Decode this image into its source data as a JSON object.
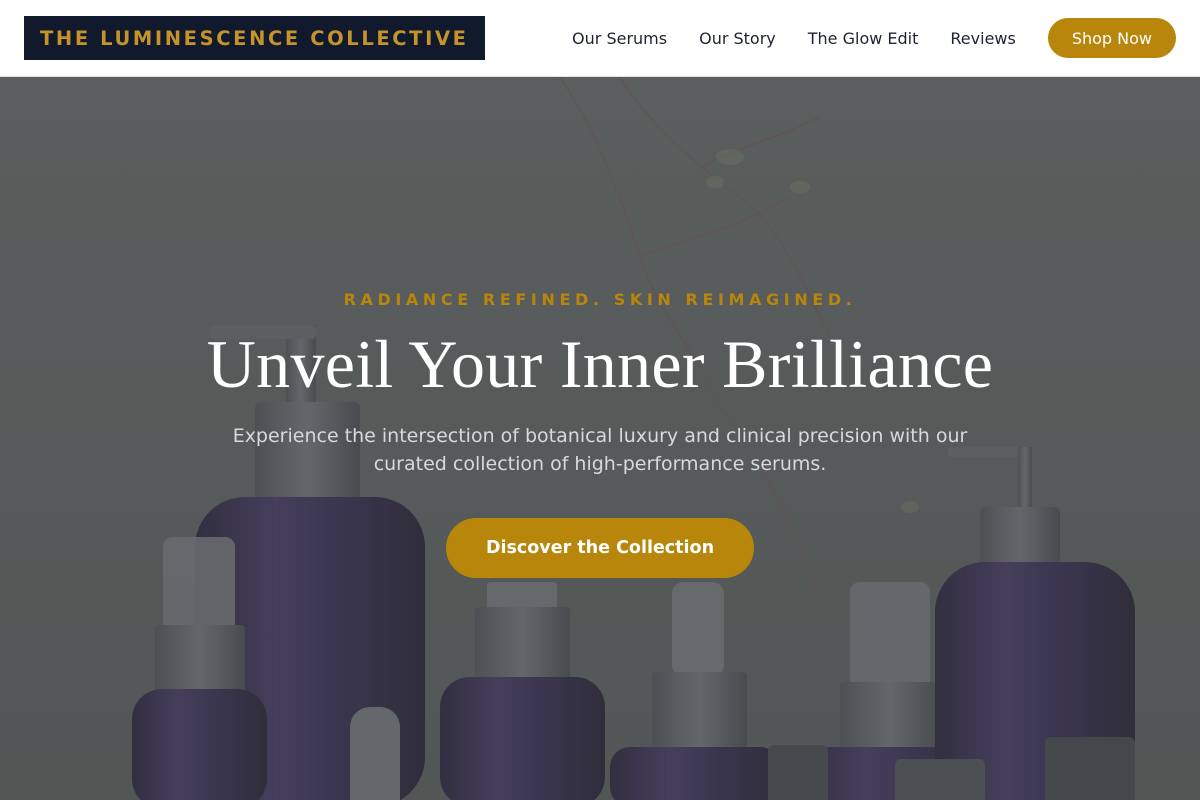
{
  "header": {
    "logo_text": "THE LUMINESCENCE COLLECTIVE",
    "nav": [
      {
        "label": "Our Serums"
      },
      {
        "label": "Our Story"
      },
      {
        "label": "The Glow Edit"
      },
      {
        "label": "Reviews"
      }
    ],
    "shop_button": "Shop Now"
  },
  "hero": {
    "tagline": "RADIANCE REFINED. SKIN REIMAGINED.",
    "headline": "Unveil Your Inner Brilliance",
    "subtext": "Experience the intersection of botanical luxury and clinical precision with our curated collection of high-performance serums.",
    "cta": "Discover the Collection",
    "background_image": "purple-glass-serum-bottles-with-pumps-and-dried-branches"
  },
  "colors": {
    "accent_gold": "#b8860b",
    "logo_background": "#111a2c",
    "nav_text": "#1d2330",
    "hero_background": "#656a68",
    "bottle_purple": "#3f3658"
  }
}
